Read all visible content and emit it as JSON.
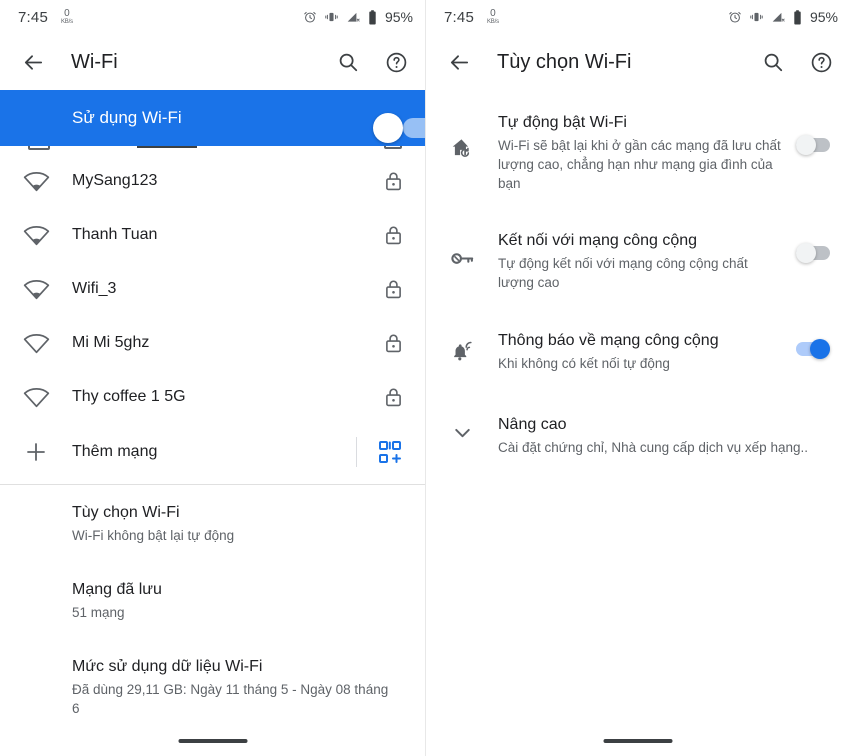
{
  "status_bar": {
    "time": "7:45",
    "net_speed_value": "0",
    "net_speed_unit": "KB/s",
    "battery_percent": "95%",
    "icons": [
      "alarm-icon",
      "vibrate-icon",
      "signal-no-service-icon",
      "battery-icon"
    ]
  },
  "left_screen": {
    "appbar": {
      "back": "back-arrow-icon",
      "title": "Wi-Fi",
      "search": "search-icon",
      "help": "help-icon"
    },
    "master_toggle": {
      "label": "Sử dụng Wi-Fi",
      "state": "on"
    },
    "networks": [
      {
        "name": "MySang123",
        "signal": 1,
        "secured": true
      },
      {
        "name": "Thanh Tuan",
        "signal": 1,
        "secured": true
      },
      {
        "name": "Wifi_3",
        "signal": 1,
        "secured": true
      },
      {
        "name": "Mi Mi 5ghz",
        "signal": 0,
        "secured": true
      },
      {
        "name": "Thy coffee 1 5G",
        "signal": 0,
        "secured": true
      }
    ],
    "add_network": {
      "label": "Thêm mạng",
      "plus_icon": "plus-icon",
      "qr_icon": "qr-scan-icon"
    },
    "options": [
      {
        "title": "Tùy chọn Wi-Fi",
        "subtitle": "Wi-Fi không bật lại tự động"
      },
      {
        "title": "Mạng đã lưu",
        "subtitle": "51 mạng"
      },
      {
        "title": "Mức sử dụng dữ liệu Wi-Fi",
        "subtitle": "Đã dùng 29,11 GB: Ngày 11 tháng 5 - Ngày 08 tháng 6"
      }
    ]
  },
  "right_screen": {
    "appbar": {
      "back": "back-arrow-icon",
      "title": "Tùy chọn Wi-Fi",
      "search": "search-icon",
      "help": "help-icon"
    },
    "settings": [
      {
        "icon": "home-auto-icon",
        "title": "Tự động bật Wi-Fi",
        "subtitle": "Wi-Fi sẽ bật lại khi ở gần các mạng đã lưu chất lượng cao, chẳng hạn như mạng gia đình của bạn",
        "toggle": "off"
      },
      {
        "icon": "key-icon",
        "title": "Kết nối với mạng công cộng",
        "subtitle": "Tự động kết nối với mạng công cộng chất lượng cao",
        "toggle": "off"
      },
      {
        "icon": "bell-wifi-icon",
        "title": "Thông báo về mạng công cộng",
        "subtitle": "Khi không có kết nối tự động",
        "toggle": "on"
      },
      {
        "icon": "chevron-down-icon",
        "title": "Nâng cao",
        "subtitle": "Cài đặt chứng chỉ, Nhà cung cấp dịch vụ xếp hạng..",
        "toggle": null
      }
    ]
  },
  "colors": {
    "accent": "#1a73e8",
    "text_primary": "#202124",
    "text_secondary": "#5f6368",
    "toggle_off_track": "#bdc1c6"
  }
}
